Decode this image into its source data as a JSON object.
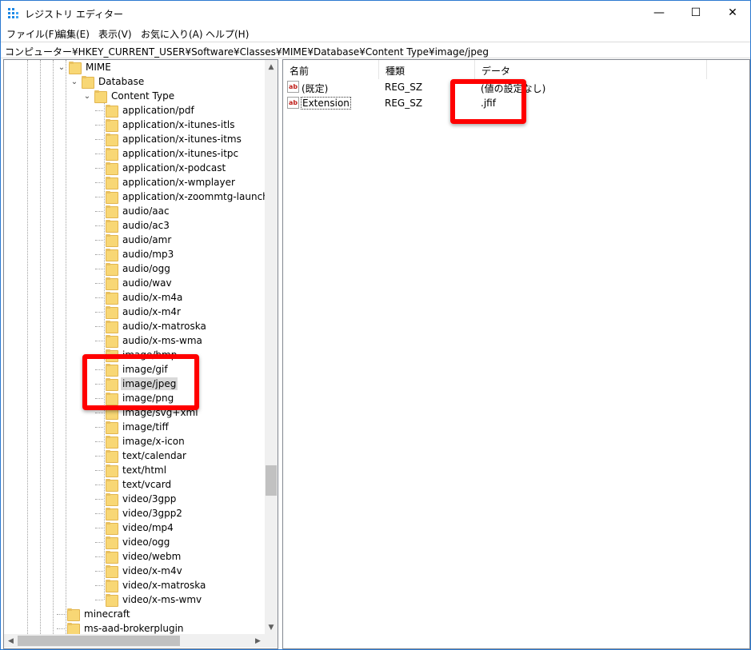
{
  "window": {
    "title": "レジストリ エディター",
    "controls": {
      "minimize": "—",
      "maximize": "☐",
      "close": "✕"
    }
  },
  "menu": [
    "ファイル(F)",
    "編集(E)",
    "表示(V)",
    "お気に入り(A)",
    "ヘルプ(H)"
  ],
  "address": "コンピューター¥HKEY_CURRENT_USER¥Software¥Classes¥MIME¥Database¥Content Type¥image/jpeg",
  "tree": {
    "nodes": [
      {
        "label": "MIME",
        "expanded": true
      },
      {
        "label": "Database",
        "expanded": true
      },
      {
        "label": "Content Type",
        "expanded": true
      },
      {
        "label": "application/pdf"
      },
      {
        "label": "application/x-itunes-itls"
      },
      {
        "label": "application/x-itunes-itms"
      },
      {
        "label": "application/x-itunes-itpc"
      },
      {
        "label": "application/x-podcast"
      },
      {
        "label": "application/x-wmplayer"
      },
      {
        "label": "application/x-zoommtg-launcher"
      },
      {
        "label": "audio/aac"
      },
      {
        "label": "audio/ac3"
      },
      {
        "label": "audio/amr"
      },
      {
        "label": "audio/mp3"
      },
      {
        "label": "audio/ogg"
      },
      {
        "label": "audio/wav"
      },
      {
        "label": "audio/x-m4a"
      },
      {
        "label": "audio/x-m4r"
      },
      {
        "label": "audio/x-matroska"
      },
      {
        "label": "audio/x-ms-wma"
      },
      {
        "label": "image/bmp"
      },
      {
        "label": "image/gif"
      },
      {
        "label": "image/jpeg",
        "selected": true
      },
      {
        "label": "image/png"
      },
      {
        "label": "image/svg+xml"
      },
      {
        "label": "image/tiff"
      },
      {
        "label": "image/x-icon"
      },
      {
        "label": "text/calendar"
      },
      {
        "label": "text/html"
      },
      {
        "label": "text/vcard"
      },
      {
        "label": "video/3gpp"
      },
      {
        "label": "video/3gpp2"
      },
      {
        "label": "video/mp4"
      },
      {
        "label": "video/ogg"
      },
      {
        "label": "video/webm"
      },
      {
        "label": "video/x-m4v"
      },
      {
        "label": "video/x-matroska"
      },
      {
        "label": "video/x-ms-wmv"
      },
      {
        "label": "minecraft"
      },
      {
        "label": "ms-aad-brokerplugin"
      }
    ],
    "scroll_up": "▲",
    "scroll_down": "▼",
    "scroll_left": "◀",
    "scroll_right": "▶"
  },
  "list": {
    "columns": {
      "name": "名前",
      "type": "種類",
      "data": "データ"
    },
    "rows": [
      {
        "icon": "ab",
        "name": "(既定)",
        "type": "REG_SZ",
        "data": "(値の設定なし)"
      },
      {
        "icon": "ab",
        "name": "Extension",
        "type": "REG_SZ",
        "data": ".jfif"
      }
    ]
  },
  "annotations": {
    "color": "#ff0000",
    "items": [
      "image/jpeg-tree-highlight",
      "jfif-data-highlight"
    ]
  }
}
